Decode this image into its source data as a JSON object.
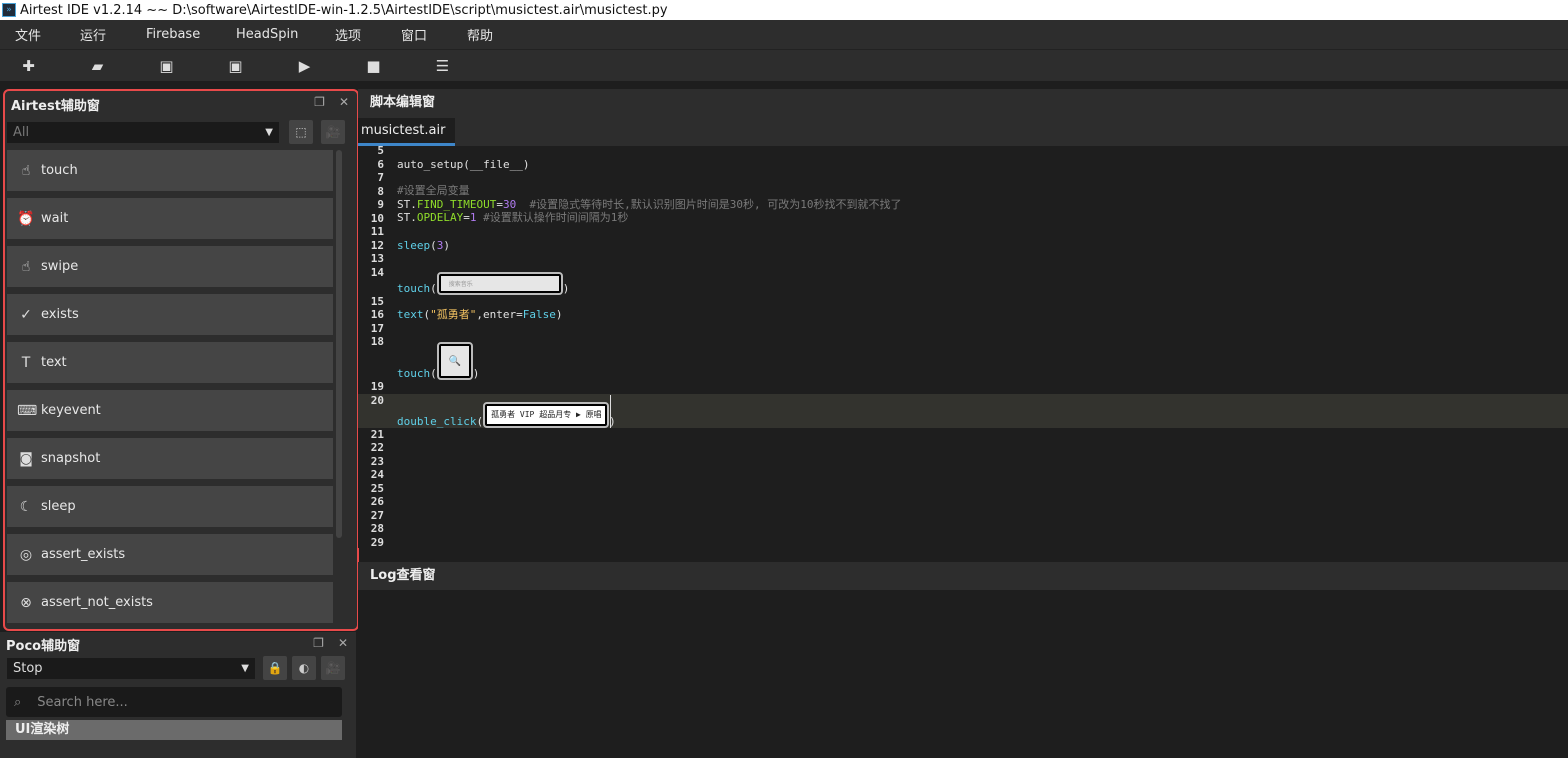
{
  "window": {
    "title": "Airtest IDE v1.2.14 ~~ D:\\software\\AirtestIDE-win-1.2.5\\AirtestIDE\\script\\musictest.air\\musictest.py"
  },
  "menu": [
    "文件",
    "运行",
    "Firebase",
    "HeadSpin",
    "选项",
    "窗口",
    "帮助"
  ],
  "toolbar": [
    {
      "icon": "new-icon",
      "glyph": "✚"
    },
    {
      "icon": "open-folder-icon",
      "glyph": "▰"
    },
    {
      "icon": "save-icon",
      "glyph": "▣"
    },
    {
      "icon": "save-as-icon",
      "glyph": "▣"
    },
    {
      "icon": "run-icon",
      "glyph": "▶"
    },
    {
      "icon": "stop-icon",
      "glyph": "■"
    },
    {
      "icon": "log-icon",
      "glyph": "☰"
    }
  ],
  "airtest_panel": {
    "title": "Airtest辅助窗",
    "filter": "All",
    "items": [
      {
        "label": "touch",
        "icon": "touch-icon",
        "glyph": "☝"
      },
      {
        "label": "wait",
        "icon": "alarm-clock-icon",
        "glyph": "⏰"
      },
      {
        "label": "swipe",
        "icon": "swipe-icon",
        "glyph": "☝"
      },
      {
        "label": "exists",
        "icon": "check-search-icon",
        "glyph": "✓"
      },
      {
        "label": "text",
        "icon": "text-icon",
        "glyph": "T"
      },
      {
        "label": "keyevent",
        "icon": "keyboard-icon",
        "glyph": "⌨"
      },
      {
        "label": "snapshot",
        "icon": "camera-icon",
        "glyph": "◙"
      },
      {
        "label": "sleep",
        "icon": "moon-icon",
        "glyph": "☾"
      },
      {
        "label": "assert_exists",
        "icon": "target-icon",
        "glyph": "◎"
      },
      {
        "label": "assert_not_exists",
        "icon": "target-x-icon",
        "glyph": "⊗"
      }
    ]
  },
  "poco_panel": {
    "title": "Poco辅助窗",
    "mode": "Stop",
    "search_placeholder": "Search here...",
    "tree_label": "UI渲染树"
  },
  "editor": {
    "title": "脚本编辑窗",
    "tab": "musictest.air",
    "lines": [
      {
        "no": "5",
        "tokens": []
      },
      {
        "no": "6",
        "tokens": [
          {
            "t": "auto_setup(__file__)",
            "c": ""
          }
        ]
      },
      {
        "no": "7",
        "tokens": []
      },
      {
        "no": "8",
        "tokens": [
          {
            "t": "#设置全局变量",
            "c": "c"
          }
        ]
      },
      {
        "no": "9",
        "tokens": [
          {
            "t": "ST.",
            "c": ""
          },
          {
            "t": "FIND_TIMEOUT",
            "c": "g"
          },
          {
            "t": "=",
            "c": ""
          },
          {
            "t": "30",
            "c": "n"
          },
          {
            "t": "  #设置隐式等待时长,默认识别图片时间是30秒, 可改为10秒找不到就不找了",
            "c": "c"
          }
        ]
      },
      {
        "no": "10",
        "tokens": [
          {
            "t": "ST.",
            "c": ""
          },
          {
            "t": "OPDELAY",
            "c": "g"
          },
          {
            "t": "=",
            "c": ""
          },
          {
            "t": "1",
            "c": "n"
          },
          {
            "t": " #设置默认操作时间间隔为1秒",
            "c": "c"
          }
        ]
      },
      {
        "no": "11",
        "tokens": []
      },
      {
        "no": "12",
        "tokens": [
          {
            "t": "sleep",
            "c": "k"
          },
          {
            "t": "(",
            "c": ""
          },
          {
            "t": "3",
            "c": "n"
          },
          {
            "t": ")",
            "c": ""
          }
        ]
      },
      {
        "no": "13",
        "tokens": []
      },
      {
        "no": "14",
        "tall": 29,
        "tokens": [
          {
            "t": "touch",
            "c": "k"
          },
          {
            "t": "(",
            "c": ""
          },
          {
            "img": "search-bar",
            "text": "搜索音乐"
          },
          {
            "t": ")",
            "c": ""
          }
        ]
      },
      {
        "no": "15",
        "tokens": []
      },
      {
        "no": "16",
        "tokens": [
          {
            "t": "text",
            "c": "k"
          },
          {
            "t": "(",
            "c": ""
          },
          {
            "t": "\"孤勇者\"",
            "c": "s"
          },
          {
            "t": ",enter=",
            "c": ""
          },
          {
            "t": "False",
            "c": "b"
          },
          {
            "t": ")",
            "c": ""
          }
        ]
      },
      {
        "no": "17",
        "tokens": []
      },
      {
        "no": "18",
        "tall": 45,
        "tokens": [
          {
            "t": "touch",
            "c": "k"
          },
          {
            "t": "(",
            "c": ""
          },
          {
            "img": "search-button",
            "text": "🔍"
          },
          {
            "t": ")",
            "c": ""
          }
        ]
      },
      {
        "no": "19",
        "tokens": []
      },
      {
        "no": "20",
        "tall": 34,
        "hl": true,
        "tokens": [
          {
            "t": "double_click",
            "c": "k"
          },
          {
            "t": "(",
            "c": ""
          },
          {
            "img": "song-result",
            "text": "孤勇者 VIP 超品月专 ▶ 原唱"
          },
          {
            "t": ")",
            "c": ""
          }
        ]
      },
      {
        "no": "21",
        "tokens": []
      },
      {
        "no": "22",
        "tokens": []
      },
      {
        "no": "23",
        "tokens": []
      },
      {
        "no": "24",
        "tokens": []
      },
      {
        "no": "25",
        "tokens": []
      },
      {
        "no": "26",
        "tokens": []
      },
      {
        "no": "27",
        "tokens": []
      },
      {
        "no": "28",
        "tokens": []
      },
      {
        "no": "29",
        "tokens": []
      }
    ]
  },
  "log": {
    "title": "Log查看窗"
  },
  "colors": {
    "highlight_border": "#e84a4a",
    "tab_accent": "#3e86c9"
  }
}
